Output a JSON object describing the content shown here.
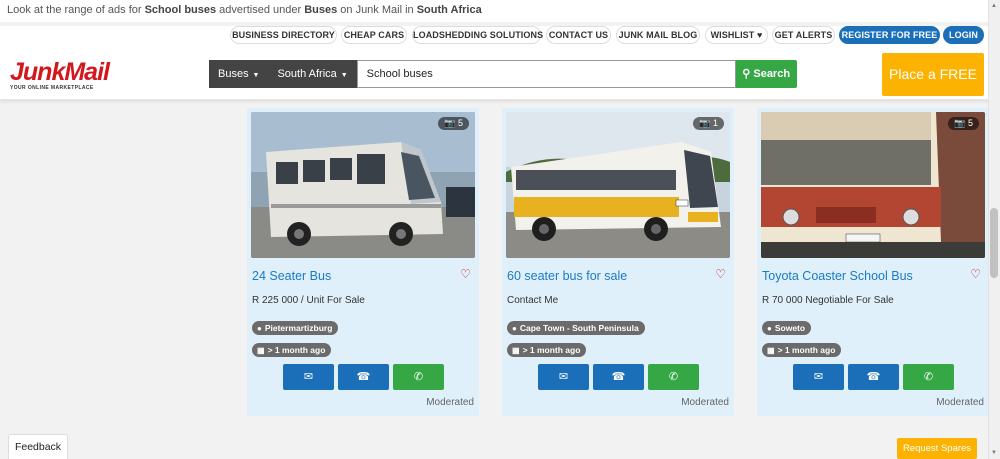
{
  "info_strip": {
    "prefix": "Look at the range of ads for ",
    "query": "School buses",
    "mid": " advertised under ",
    "category": "Buses",
    "mid2": " on Junk Mail in ",
    "region": "South Africa"
  },
  "top_links": [
    "BUSINESS DIRECTORY",
    "CHEAP CARS",
    "LOADSHEDDING SOLUTIONS",
    "CONTACT US",
    "JUNK MAIL BLOG",
    "WISHLIST ♥",
    "GET ALERTS",
    "REGISTER FOR FREE",
    "LOGIN"
  ],
  "logo": {
    "text": "JunkMail",
    "tagline": "YOUR ONLINE MARKETPLACE"
  },
  "search": {
    "category": "Buses",
    "region": "South Africa",
    "query": "School buses",
    "button": "Search"
  },
  "place_ad": "Place a FREE Ad",
  "listings": [
    {
      "title": "24 Seater Bus",
      "price": "R 225 000 / Unit For Sale",
      "location": "Pietermartizburg",
      "age": "> 1 month ago",
      "photos": "5",
      "status": "Moderated"
    },
    {
      "title": "60 seater bus for sale",
      "price": "Contact Me",
      "location": "Cape Town - South Peninsula",
      "age": "> 1 month ago",
      "photos": "1",
      "status": "Moderated"
    },
    {
      "title": "Toyota Coaster School Bus",
      "price": "R 70 000 Negotiable For Sale",
      "location": "Soweto",
      "age": "> 1 month ago",
      "photos": "5",
      "status": "Moderated"
    }
  ],
  "feedback": "Feedback",
  "request_spares": "Request Spares",
  "colors": {
    "brand_red": "#d4171d",
    "primary_blue": "#1b6fb8",
    "green": "#35a845",
    "accent_orange": "#fcb200",
    "card_bg": "#dff0fa"
  }
}
